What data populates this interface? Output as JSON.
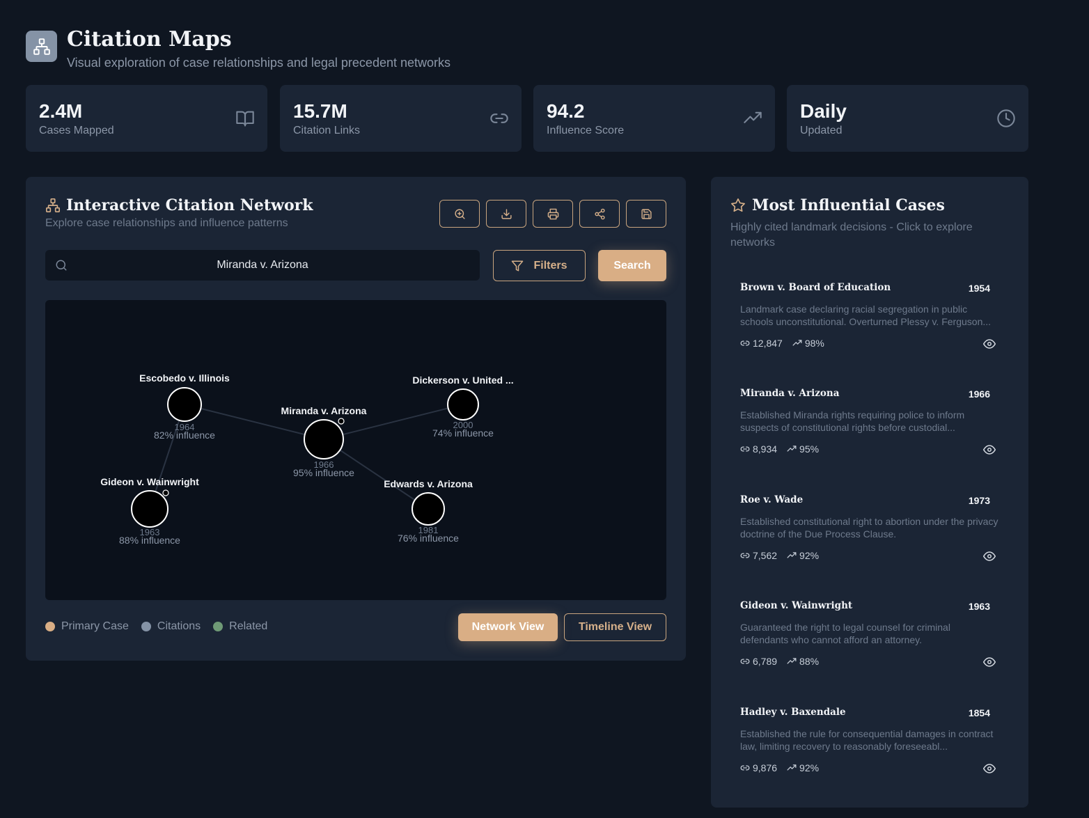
{
  "header": {
    "title": "Citation Maps",
    "subtitle": "Visual exploration of case relationships and legal precedent networks",
    "logo_icon": "hierarchy-icon"
  },
  "stats": [
    {
      "value": "2.4M",
      "label": "Cases Mapped",
      "icon": "book-icon"
    },
    {
      "value": "15.7M",
      "label": "Citation Links",
      "icon": "link-icon"
    },
    {
      "value": "94.2",
      "label": "Influence Score",
      "icon": "trending-up-icon"
    },
    {
      "value": "Daily",
      "label": "Updated",
      "icon": "clock-icon"
    }
  ],
  "network": {
    "title": "Interactive Citation Network",
    "subtitle": "Explore case relationships and influence patterns",
    "toolbar_icons": [
      "zoom-in-icon",
      "download-icon",
      "print-icon",
      "share-icon",
      "save-icon"
    ],
    "search": {
      "value": "Miranda v. Arizona"
    },
    "filters_label": "Filters",
    "search_label": "Search",
    "nodes": [
      {
        "name": "Escobedo v. Illinois",
        "year": "1964",
        "influence": "82% influence"
      },
      {
        "name": "Miranda v. Arizona",
        "year": "1966",
        "influence": "95% influence"
      },
      {
        "name": "Dickerson v. United ...",
        "year": "2000",
        "influence": "74% influence"
      },
      {
        "name": "Gideon v. Wainwright",
        "year": "1963",
        "influence": "88% influence"
      },
      {
        "name": "Edwards v. Arizona",
        "year": "1981",
        "influence": "76% influence"
      }
    ],
    "legend": [
      {
        "label": "Primary Case",
        "color": "#d9ae85"
      },
      {
        "label": "Citations",
        "color": "#8593a6"
      },
      {
        "label": "Related",
        "color": "#6f9a76"
      }
    ],
    "network_view_label": "Network View",
    "timeline_view_label": "Timeline View"
  },
  "influential": {
    "title": "Most Influential Cases",
    "subtitle": "Highly cited landmark decisions - Click to explore networks",
    "cases": [
      {
        "name": "Brown v. Board of Education",
        "year": "1954",
        "desc": "Landmark case declaring racial segregation in public schools unconstitutional. Overturned Plessy v. Ferguson...",
        "citations": "12,847",
        "score": "98%"
      },
      {
        "name": "Miranda v. Arizona",
        "year": "1966",
        "desc": "Established Miranda rights requiring police to inform suspects of constitutional rights before custodial...",
        "citations": "8,934",
        "score": "95%"
      },
      {
        "name": "Roe v. Wade",
        "year": "1973",
        "desc": "Established constitutional right to abortion under the privacy doctrine of the Due Process Clause.",
        "citations": "7,562",
        "score": "92%"
      },
      {
        "name": "Gideon v. Wainwright",
        "year": "1963",
        "desc": "Guaranteed the right to legal counsel for criminal defendants who cannot afford an attorney.",
        "citations": "6,789",
        "score": "88%"
      },
      {
        "name": "Hadley v. Baxendale",
        "year": "1854",
        "desc": "Established the rule for consequential damages in contract law, limiting recovery to reasonably foreseeabl...",
        "citations": "9,876",
        "score": "92%"
      }
    ]
  }
}
